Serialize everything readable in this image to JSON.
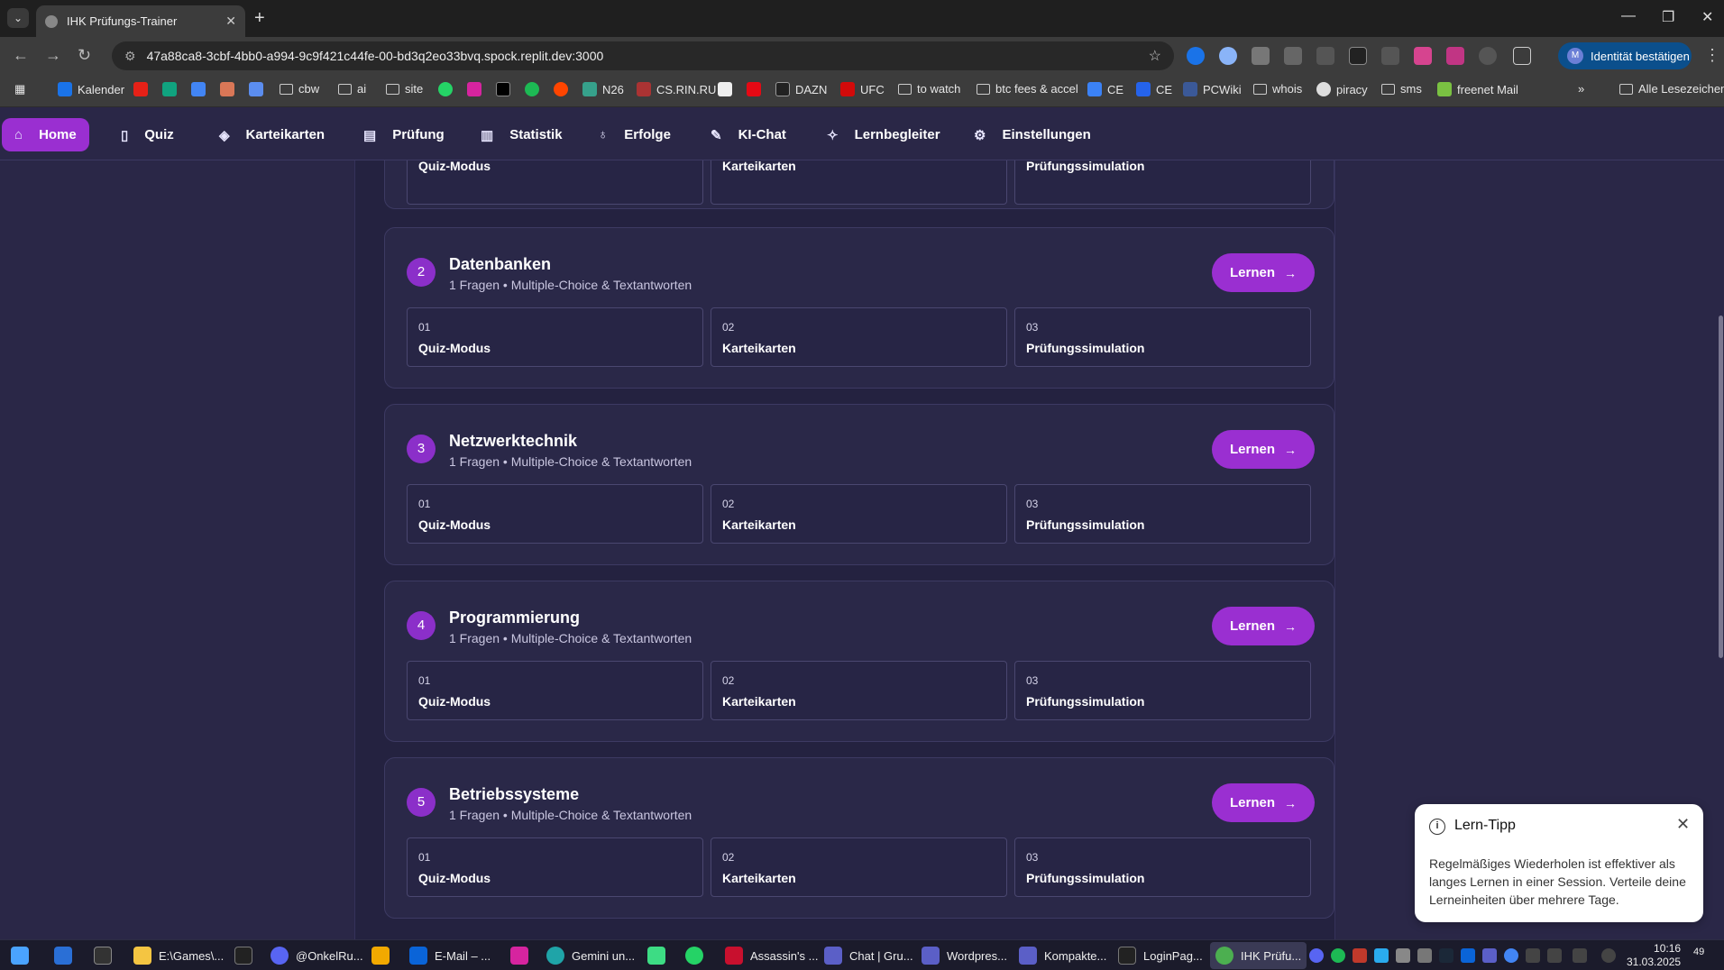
{
  "browser": {
    "tab_title": "IHK Prüfungs-Trainer",
    "url": "47a88ca8-3cbf-4bb0-a994-9c9f421c44fe-00-bd3q2eo33bvq.spock.replit.dev:3000",
    "identity_label": "Identität bestätigen",
    "identity_avatar": "M",
    "bookmarks": [
      "Kalender",
      "cbw",
      "ai",
      "site",
      "N26",
      "CS.RIN.RU",
      "DAZN",
      "UFC",
      "to watch",
      "btc fees & accel",
      "CE",
      "CE",
      "PCWiki",
      "whois",
      "piracy",
      "sms",
      "freenet Mail"
    ],
    "all_bookmarks_label": "Alle Lesezeichen"
  },
  "nav": {
    "items": [
      {
        "label": "Home",
        "icon": "home-icon"
      },
      {
        "label": "Quiz",
        "icon": "book-icon"
      },
      {
        "label": "Karteikarten",
        "icon": "layers-icon"
      },
      {
        "label": "Prüfung",
        "icon": "clipboard-icon"
      },
      {
        "label": "Statistik",
        "icon": "chart-icon"
      },
      {
        "label": "Erfolge",
        "icon": "award-icon"
      },
      {
        "label": "KI-Chat",
        "icon": "brain-icon"
      },
      {
        "label": "Lernbegleiter",
        "icon": "sparkle-icon"
      },
      {
        "label": "Einstellungen",
        "icon": "gear-icon"
      }
    ],
    "active": "Home"
  },
  "topics_partial": {
    "modes": [
      {
        "num": "01",
        "name": "Quiz-Modus"
      },
      {
        "num": "02",
        "name": "Karteikarten"
      },
      {
        "num": "03",
        "name": "Prüfungssimulation"
      }
    ]
  },
  "topics": [
    {
      "number": "2",
      "title": "Datenbanken",
      "subtitle": "1 Fragen • Multiple-Choice & Textantworten",
      "button": "Lernen",
      "modes": [
        {
          "num": "01",
          "name": "Quiz-Modus"
        },
        {
          "num": "02",
          "name": "Karteikarten"
        },
        {
          "num": "03",
          "name": "Prüfungssimulation"
        }
      ]
    },
    {
      "number": "3",
      "title": "Netzwerktechnik",
      "subtitle": "1 Fragen • Multiple-Choice & Textantworten",
      "button": "Lernen",
      "modes": [
        {
          "num": "01",
          "name": "Quiz-Modus"
        },
        {
          "num": "02",
          "name": "Karteikarten"
        },
        {
          "num": "03",
          "name": "Prüfungssimulation"
        }
      ]
    },
    {
      "number": "4",
      "title": "Programmierung",
      "subtitle": "1 Fragen • Multiple-Choice & Textantworten",
      "button": "Lernen",
      "modes": [
        {
          "num": "01",
          "name": "Quiz-Modus"
        },
        {
          "num": "02",
          "name": "Karteikarten"
        },
        {
          "num": "03",
          "name": "Prüfungssimulation"
        }
      ]
    },
    {
      "number": "5",
      "title": "Betriebssysteme",
      "subtitle": "1 Fragen • Multiple-Choice & Textantworten",
      "button": "Lernen",
      "modes": [
        {
          "num": "01",
          "name": "Quiz-Modus"
        },
        {
          "num": "02",
          "name": "Karteikarten"
        },
        {
          "num": "03",
          "name": "Prüfungssimulation"
        }
      ]
    }
  ],
  "toast": {
    "title": "Lern-Tipp",
    "body": "Regelmäßiges Wiederholen ist effektiver als langes Lernen in einer Session. Verteile deine Lerneinheiten über mehrere Tage."
  },
  "taskbar": {
    "apps": [
      "E:\\Games\\...",
      "@OnkelRu...",
      "E-Mail – ...",
      "Gemini un...",
      "Assassin's ...",
      "Chat | Gru...",
      "Wordpres...",
      "Kompakte...",
      "LoginPag...",
      "IHK Prüfu..."
    ],
    "time": "10:16",
    "date": "31.03.2025",
    "notification_count": "49"
  },
  "colors": {
    "accent": "#9a2fd1",
    "background": "#2a2747",
    "card": "#2a2848"
  }
}
